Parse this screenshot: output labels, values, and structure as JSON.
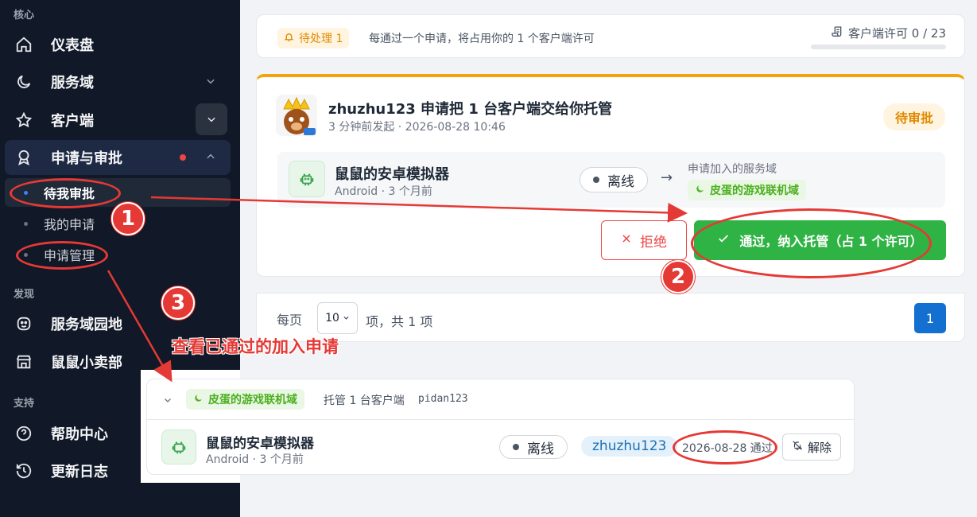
{
  "sidebar": {
    "sections": {
      "core": "核心",
      "discover": "发现",
      "support": "支持"
    },
    "items": {
      "dashboard": "仪表盘",
      "service_domain": "服务域",
      "client": "客户端",
      "requests": "申请与审批",
      "pending_review": "待我审批",
      "my_requests": "我的申请",
      "request_mgmt": "申请管理",
      "domain_garden": "服务域园地",
      "shop": "鼠鼠小卖部",
      "help": "帮助中心",
      "changelog": "更新日志"
    }
  },
  "top_bar": {
    "pending_badge": "待处理 1",
    "notice": "每通过一个申请，将占用你的 1 个客户端许可",
    "license_label": "客户端许可 0 / 23",
    "license_used": 0,
    "license_total": 23
  },
  "request": {
    "title": "zhuzhu123 申请把 1 台客户端交给你托管",
    "meta": "3 分钟前发起 · 2026-08-28 10:46",
    "status": "待审批",
    "device_name": "鼠鼠的安卓模拟器",
    "device_meta": "Android · 3 个月前",
    "device_status": "离线",
    "join_label": "申请加入的服务域",
    "domain_tag": "皮蛋的游戏联机域",
    "reject_label": "拒绝",
    "approve_label": "通过，纳入托管（占 1 个许可）"
  },
  "pagination": {
    "per_page_label": "每页",
    "per_page_value": "10",
    "total_label": "项，共 1 项",
    "current_page": "1"
  },
  "annotations": {
    "n1": "1",
    "n2": "2",
    "n3": "3",
    "caption": "查看已通过的加入申请",
    "color": "#e53935"
  },
  "managed": {
    "domain_tag": "皮蛋的游戏联机域",
    "summary": "托管 1 台客户端",
    "owner": "pidan123",
    "device_name": "鼠鼠的安卓模拟器",
    "device_meta": "Android · 3 个月前",
    "device_status": "离线",
    "user": "zhuzhu123",
    "approved": "2026-08-28 通过",
    "remove_label": "解除"
  }
}
